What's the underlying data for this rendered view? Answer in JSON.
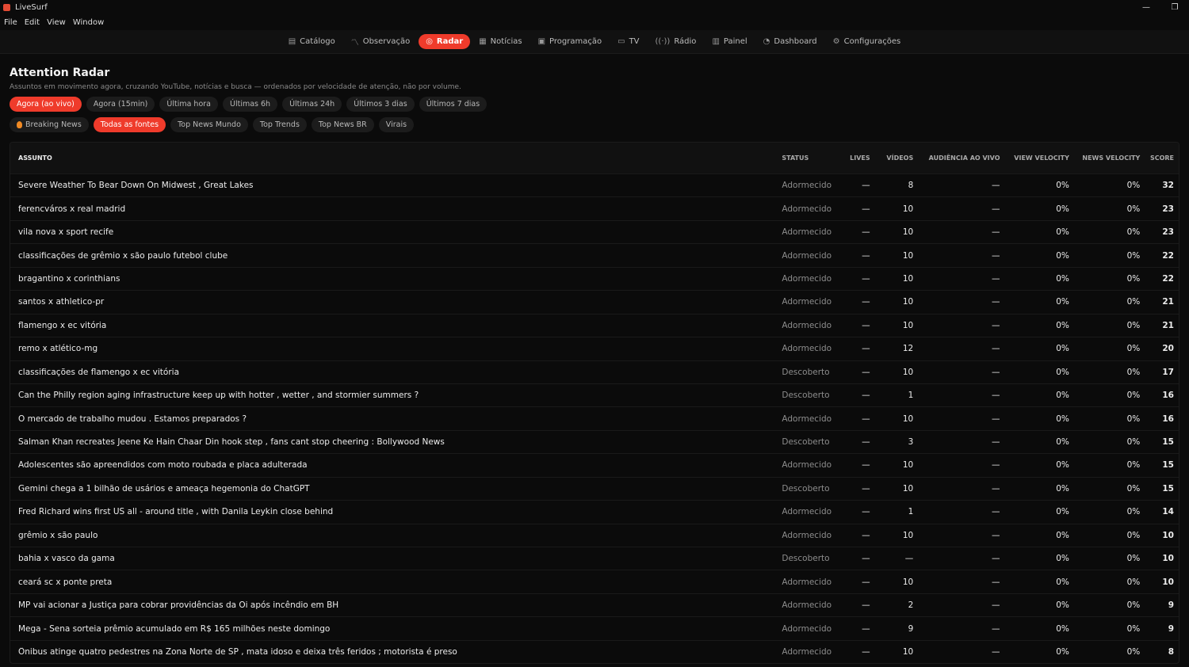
{
  "window": {
    "title": "LiveSurf",
    "minimize": "—",
    "restore": "❐"
  },
  "menu": [
    "File",
    "Edit",
    "View",
    "Window"
  ],
  "nav": [
    {
      "label": "Catálogo",
      "icon": "▤",
      "active": false
    },
    {
      "label": "Observação",
      "icon": "〽",
      "active": false
    },
    {
      "label": "Radar",
      "icon": "◎",
      "active": true
    },
    {
      "label": "Notícias",
      "icon": "▦",
      "active": false
    },
    {
      "label": "Programação",
      "icon": "▣",
      "active": false
    },
    {
      "label": "TV",
      "icon": "▭",
      "active": false
    },
    {
      "label": "Rádio",
      "icon": "((·))",
      "active": false
    },
    {
      "label": "Painel",
      "icon": "▥",
      "active": false
    },
    {
      "label": "Dashboard",
      "icon": "◔",
      "active": false
    },
    {
      "label": "Configurações",
      "icon": "⚙",
      "active": false
    }
  ],
  "page": {
    "title": "Attention Radar",
    "subtitle": "Assuntos em movimento agora, cruzando YouTube, notícias e busca — ordenados por velocidade de atenção, não por volume."
  },
  "time_filters": [
    {
      "label": "Agora (ao vivo)",
      "active": true
    },
    {
      "label": "Agora (15min)",
      "active": false
    },
    {
      "label": "Última hora",
      "active": false
    },
    {
      "label": "Últimas 6h",
      "active": false
    },
    {
      "label": "Últimas 24h",
      "active": false
    },
    {
      "label": "Últimos 3 dias",
      "active": false
    },
    {
      "label": "Últimos 7 dias",
      "active": false
    }
  ],
  "source_filters": [
    {
      "label": "Breaking News",
      "active": false,
      "icon": "fire-icon"
    },
    {
      "label": "Todas as fontes",
      "active": true
    },
    {
      "label": "Top News Mundo",
      "active": false
    },
    {
      "label": "Top Trends",
      "active": false
    },
    {
      "label": "Top News BR",
      "active": false
    },
    {
      "label": "Virais",
      "active": false
    }
  ],
  "columns": {
    "subject": "ASSUNTO",
    "status": "STATUS",
    "lives": "LIVES",
    "videos": "VÍDEOS",
    "audience": "AUDIÊNCIA AO VIVO",
    "view_velocity": "VIEW VELOCITY",
    "news_velocity": "NEWS VELOCITY",
    "score": "SCORE"
  },
  "rows": [
    {
      "subject": "Severe Weather To Bear Down On Midwest , Great Lakes",
      "status": "Adormecido",
      "lives": "—",
      "videos": "8",
      "audience": "—",
      "view_velocity": "0%",
      "news_velocity": "0%",
      "score": "32"
    },
    {
      "subject": "ferencváros x real madrid",
      "status": "Adormecido",
      "lives": "—",
      "videos": "10",
      "audience": "—",
      "view_velocity": "0%",
      "news_velocity": "0%",
      "score": "23"
    },
    {
      "subject": "vila nova x sport recife",
      "status": "Adormecido",
      "lives": "—",
      "videos": "10",
      "audience": "—",
      "view_velocity": "0%",
      "news_velocity": "0%",
      "score": "23"
    },
    {
      "subject": "classificações de grêmio x são paulo futebol clube",
      "status": "Adormecido",
      "lives": "—",
      "videos": "10",
      "audience": "—",
      "view_velocity": "0%",
      "news_velocity": "0%",
      "score": "22"
    },
    {
      "subject": "bragantino x corinthians",
      "status": "Adormecido",
      "lives": "—",
      "videos": "10",
      "audience": "—",
      "view_velocity": "0%",
      "news_velocity": "0%",
      "score": "22"
    },
    {
      "subject": "santos x athletico-pr",
      "status": "Adormecido",
      "lives": "—",
      "videos": "10",
      "audience": "—",
      "view_velocity": "0%",
      "news_velocity": "0%",
      "score": "21"
    },
    {
      "subject": "flamengo x ec vitória",
      "status": "Adormecido",
      "lives": "—",
      "videos": "10",
      "audience": "—",
      "view_velocity": "0%",
      "news_velocity": "0%",
      "score": "21"
    },
    {
      "subject": "remo x atlético-mg",
      "status": "Adormecido",
      "lives": "—",
      "videos": "12",
      "audience": "—",
      "view_velocity": "0%",
      "news_velocity": "0%",
      "score": "20"
    },
    {
      "subject": "classificações de flamengo x ec vitória",
      "status": "Descoberto",
      "lives": "—",
      "videos": "10",
      "audience": "—",
      "view_velocity": "0%",
      "news_velocity": "0%",
      "score": "17"
    },
    {
      "subject": "Can the Philly region aging infrastructure keep up with hotter , wetter , and stormier summers ?",
      "status": "Descoberto",
      "lives": "—",
      "videos": "1",
      "audience": "—",
      "view_velocity": "0%",
      "news_velocity": "0%",
      "score": "16"
    },
    {
      "subject": "O mercado de trabalho mudou . Estamos preparados ?",
      "status": "Adormecido",
      "lives": "—",
      "videos": "10",
      "audience": "—",
      "view_velocity": "0%",
      "news_velocity": "0%",
      "score": "16"
    },
    {
      "subject": "Salman Khan recreates Jeene Ke Hain Chaar Din hook step , fans cant stop cheering : Bollywood News",
      "status": "Descoberto",
      "lives": "—",
      "videos": "3",
      "audience": "—",
      "view_velocity": "0%",
      "news_velocity": "0%",
      "score": "15"
    },
    {
      "subject": "Adolescentes são apreendidos com moto roubada e placa adulterada",
      "status": "Adormecido",
      "lives": "—",
      "videos": "10",
      "audience": "—",
      "view_velocity": "0%",
      "news_velocity": "0%",
      "score": "15"
    },
    {
      "subject": "Gemini chega a 1 bilhão de usários e ameaça hegemonia do ChatGPT",
      "status": "Descoberto",
      "lives": "—",
      "videos": "10",
      "audience": "—",
      "view_velocity": "0%",
      "news_velocity": "0%",
      "score": "15"
    },
    {
      "subject": "Fred Richard wins first US all - around title , with Danila Leykin close behind",
      "status": "Adormecido",
      "lives": "—",
      "videos": "1",
      "audience": "—",
      "view_velocity": "0%",
      "news_velocity": "0%",
      "score": "14"
    },
    {
      "subject": "grêmio x são paulo",
      "status": "Adormecido",
      "lives": "—",
      "videos": "10",
      "audience": "—",
      "view_velocity": "0%",
      "news_velocity": "0%",
      "score": "10"
    },
    {
      "subject": "bahia x vasco da gama",
      "status": "Descoberto",
      "lives": "—",
      "videos": "—",
      "audience": "—",
      "view_velocity": "0%",
      "news_velocity": "0%",
      "score": "10"
    },
    {
      "subject": "ceará sc x ponte preta",
      "status": "Adormecido",
      "lives": "—",
      "videos": "10",
      "audience": "—",
      "view_velocity": "0%",
      "news_velocity": "0%",
      "score": "10"
    },
    {
      "subject": "MP vai acionar a Justiça para cobrar providências da Oi após incêndio em BH",
      "status": "Adormecido",
      "lives": "—",
      "videos": "2",
      "audience": "—",
      "view_velocity": "0%",
      "news_velocity": "0%",
      "score": "9"
    },
    {
      "subject": "Mega - Sena sorteia prêmio acumulado em R$ 165 milhões neste domingo",
      "status": "Adormecido",
      "lives": "—",
      "videos": "9",
      "audience": "—",
      "view_velocity": "0%",
      "news_velocity": "0%",
      "score": "9"
    },
    {
      "subject": "Ônibus atinge quatro pedestres na Zona Norte de SP , mata idoso e deixa três feridos ; motorista é preso",
      "status": "Adormecido",
      "lives": "—",
      "videos": "10",
      "audience": "—",
      "view_velocity": "0%",
      "news_velocity": "0%",
      "score": "8"
    }
  ]
}
